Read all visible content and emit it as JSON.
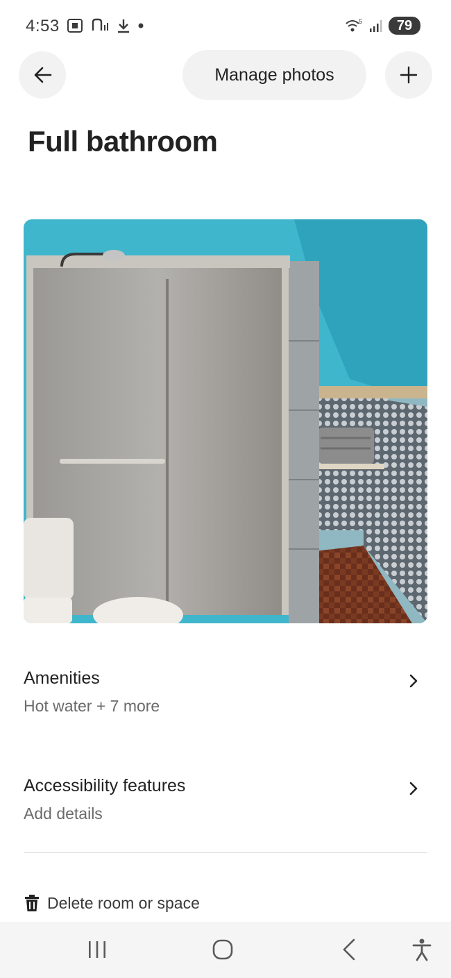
{
  "status": {
    "time": "4:53",
    "battery": "79",
    "wifi_label": "5"
  },
  "header": {
    "manage_label": "Manage photos",
    "back_icon": "arrow-left-icon",
    "add_icon": "plus-icon"
  },
  "page": {
    "title": "Full bathroom"
  },
  "rows": [
    {
      "title": "Amenities",
      "subtitle": "Hot water + 7 more"
    },
    {
      "title": "Accessibility features",
      "subtitle": "Add details"
    }
  ],
  "delete": {
    "label": "Delete room or space",
    "icon": "trash-icon"
  },
  "nav": {
    "items": [
      "recents-icon",
      "home-icon",
      "back-icon",
      "accessibility-icon"
    ]
  },
  "colors": {
    "wall": "#3fb6cc",
    "chip_bg": "#f2f2f2",
    "text": "#222222",
    "muted": "#6a6a6a"
  }
}
